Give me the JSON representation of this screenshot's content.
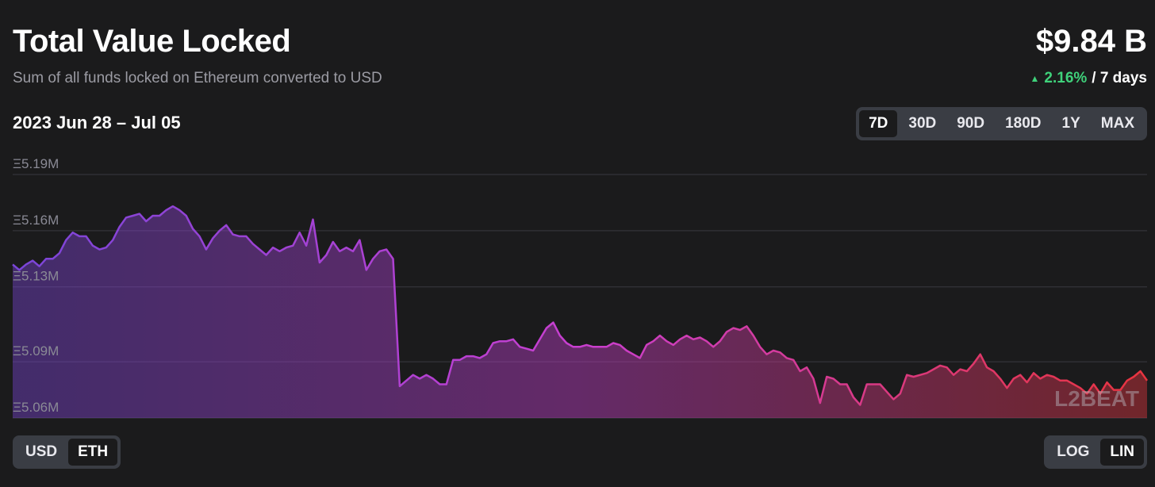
{
  "header": {
    "title": "Total Value Locked",
    "subtitle": "Sum of all funds locked on Ethereum converted to USD",
    "value": "$9.84 B",
    "change_pct": "2.16%",
    "change_period": "/ 7 days",
    "up_color": "#3fd17a"
  },
  "date_range": "2023 Jun 28 – Jul 05",
  "period_options": [
    "7D",
    "30D",
    "90D",
    "180D",
    "1Y",
    "MAX"
  ],
  "period_selected": "7D",
  "unit_options": [
    "USD",
    "ETH"
  ],
  "unit_selected": "ETH",
  "scale_options": [
    "LOG",
    "LIN"
  ],
  "scale_selected": "LIN",
  "watermark": "L2BEAT",
  "chart_data": {
    "type": "area",
    "title": "",
    "xlabel": "",
    "ylabel": "",
    "y_ticks": [
      "Ξ5.06M",
      "Ξ5.09M",
      "Ξ5.13M",
      "Ξ5.16M",
      "Ξ5.19M"
    ],
    "y_tick_values": [
      5.06,
      5.09,
      5.13,
      5.16,
      5.19
    ],
    "ylim": [
      5.06,
      5.19
    ],
    "x_range": [
      "2023-06-28",
      "2023-07-05"
    ],
    "grid": true,
    "gradient_colors": [
      "#7a45d8",
      "#c93fd0",
      "#e8343e"
    ],
    "values": [
      5.142,
      5.139,
      5.142,
      5.144,
      5.141,
      5.145,
      5.145,
      5.148,
      5.155,
      5.159,
      5.157,
      5.157,
      5.152,
      5.15,
      5.151,
      5.155,
      5.162,
      5.167,
      5.168,
      5.169,
      5.165,
      5.168,
      5.168,
      5.171,
      5.173,
      5.171,
      5.168,
      5.161,
      5.157,
      5.15,
      5.156,
      5.16,
      5.163,
      5.158,
      5.157,
      5.157,
      5.153,
      5.15,
      5.147,
      5.151,
      5.149,
      5.151,
      5.152,
      5.159,
      5.152,
      5.166,
      5.143,
      5.147,
      5.154,
      5.149,
      5.151,
      5.149,
      5.155,
      5.139,
      5.145,
      5.149,
      5.15,
      5.145,
      5.077,
      5.08,
      5.083,
      5.081,
      5.083,
      5.081,
      5.078,
      5.078,
      5.091,
      5.091,
      5.093,
      5.093,
      5.092,
      5.094,
      5.1,
      5.101,
      5.101,
      5.102,
      5.098,
      5.097,
      5.096,
      5.102,
      5.108,
      5.111,
      5.104,
      5.1,
      5.098,
      5.098,
      5.099,
      5.098,
      5.098,
      5.098,
      5.1,
      5.099,
      5.096,
      5.094,
      5.092,
      5.099,
      5.101,
      5.104,
      5.101,
      5.099,
      5.102,
      5.104,
      5.102,
      5.103,
      5.101,
      5.098,
      5.101,
      5.106,
      5.108,
      5.107,
      5.109,
      5.104,
      5.098,
      5.094,
      5.096,
      5.095,
      5.092,
      5.091,
      5.085,
      5.087,
      5.081,
      5.068,
      5.082,
      5.081,
      5.078,
      5.078,
      5.071,
      5.067,
      5.078,
      5.078,
      5.078,
      5.074,
      5.07,
      5.073,
      5.083,
      5.082,
      5.083,
      5.084,
      5.086,
      5.088,
      5.087,
      5.083,
      5.086,
      5.085,
      5.089,
      5.094,
      5.087,
      5.085,
      5.081,
      5.076,
      5.081,
      5.083,
      5.079,
      5.084,
      5.081,
      5.083,
      5.082,
      5.08,
      5.08,
      5.078,
      5.076,
      5.073,
      5.078,
      5.073,
      5.079,
      5.075,
      5.075,
      5.08,
      5.082,
      5.085,
      5.08
    ]
  }
}
